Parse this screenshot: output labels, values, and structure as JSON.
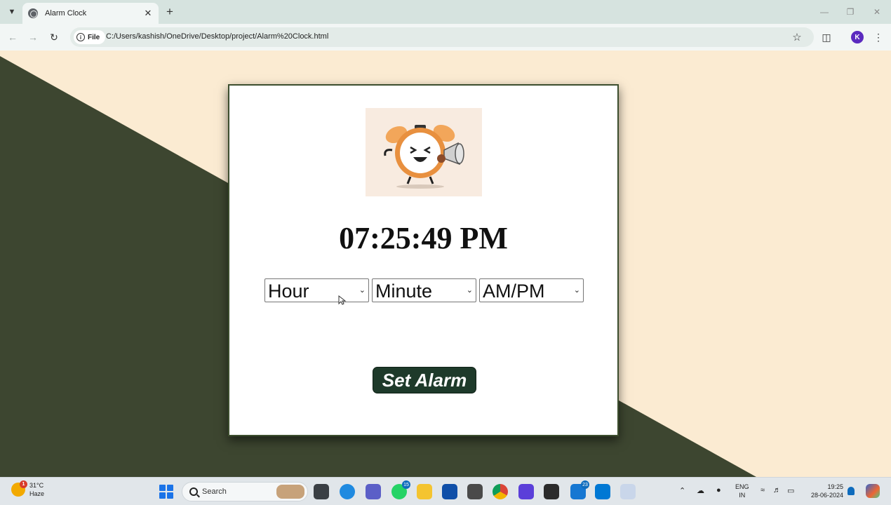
{
  "browser": {
    "tab_title": "Alarm Clock",
    "site_info_label": "File",
    "url": "C:/Users/kashish/OneDrive/Desktop/project/Alarm%20Clock.html",
    "profile_initial": "K",
    "icons": {
      "tab_menu": "chevron-down-icon",
      "tab_favicon": "globe-icon",
      "tab_close": "close-icon",
      "new_tab": "plus-icon",
      "back": "arrow-left-icon",
      "forward": "arrow-right-icon",
      "reload": "reload-icon",
      "bookmark": "star-icon",
      "extensions": "puzzle-icon",
      "menu": "more-vertical-icon",
      "minimize": "minimize-icon",
      "restore": "restore-icon",
      "close_window": "close-icon"
    }
  },
  "app": {
    "clock_image": "alarm-clock-illustration",
    "time": "07:25:49 PM",
    "selects": [
      {
        "id": "hour",
        "value": "Hour"
      },
      {
        "id": "minute",
        "value": "Minute"
      },
      {
        "id": "ampm",
        "value": "AM/PM"
      }
    ],
    "set_alarm_label": "Set Alarm",
    "colors": {
      "background_dark": "#3d4630",
      "background_light": "#fbebd2",
      "button": "#1e3a2a",
      "card": "#ffffff"
    }
  },
  "taskbar": {
    "weather_temp": "31°C",
    "weather_desc": "Haze",
    "weather_alert_count": "1",
    "search_label": "Search",
    "app_badges": {
      "whatsapp": "15",
      "outlook": "23"
    },
    "language_line1": "ENG",
    "language_line2": "IN",
    "clock_time": "19:25",
    "clock_date": "28-06-2024"
  }
}
